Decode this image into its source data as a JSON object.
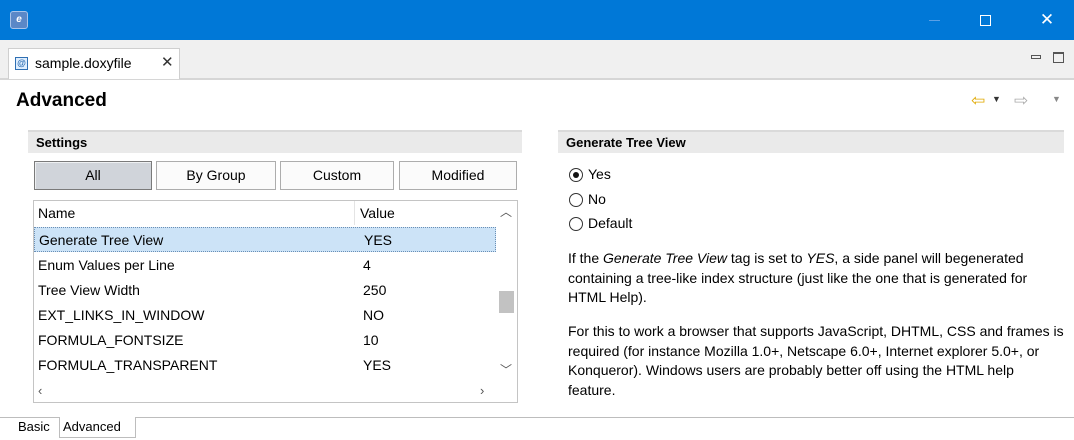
{
  "window": {
    "app_icon": "e",
    "close_glyph": "✕"
  },
  "editor": {
    "tab_label": "sample.doxyfile",
    "tab_close": "✕",
    "file_icon": "@"
  },
  "page": {
    "title": "Advanced"
  },
  "settings": {
    "header": "Settings",
    "filters": {
      "all": "All",
      "by_group": "By Group",
      "custom": "Custom",
      "modified": "Modified"
    },
    "active_filter": "All",
    "columns": {
      "name": "Name",
      "value": "Value"
    },
    "rows": [
      {
        "name": "Generate Tree View",
        "value": "YES"
      },
      {
        "name": "Enum Values per Line",
        "value": "4"
      },
      {
        "name": "Tree View Width",
        "value": "250"
      },
      {
        "name": "EXT_LINKS_IN_WINDOW",
        "value": "NO"
      },
      {
        "name": "FORMULA_FONTSIZE",
        "value": "10"
      },
      {
        "name": "FORMULA_TRANSPARENT",
        "value": "YES"
      }
    ],
    "selected_row": 0
  },
  "detail": {
    "header": "Generate Tree View",
    "options": {
      "yes": "Yes",
      "no": "No",
      "default": "Default"
    },
    "selected_option": "Yes",
    "desc1": {
      "p1": "If the ",
      "em1": "Generate Tree View",
      "p2": " tag is set to ",
      "em2": "YES",
      "p3": ", a side panel will begenerated containing a tree-like index structure (just like the one that is generated for HTML Help)."
    },
    "desc2": "For this to work a browser that supports JavaScript, DHTML, CSS and frames is required (for instance Mozilla 1.0+, Netscape 6.0+, Internet explorer 5.0+, or Konqueror). Windows users are probably better off using the HTML help feature."
  },
  "page_tabs": {
    "basic": "Basic",
    "advanced": "Advanced"
  },
  "colors": {
    "title_bar": "#0078d7",
    "selection": "#cce3f7",
    "nav_back": "#e0a800"
  },
  "icons": [
    "app-icon",
    "file-icon",
    "close-icon",
    "minimize-icon",
    "maximize-icon",
    "back-arrow-icon",
    "forward-arrow-icon",
    "chevron-down-icon",
    "scroll-up-icon",
    "scroll-down-icon",
    "scroll-left-icon",
    "scroll-right-icon"
  ]
}
